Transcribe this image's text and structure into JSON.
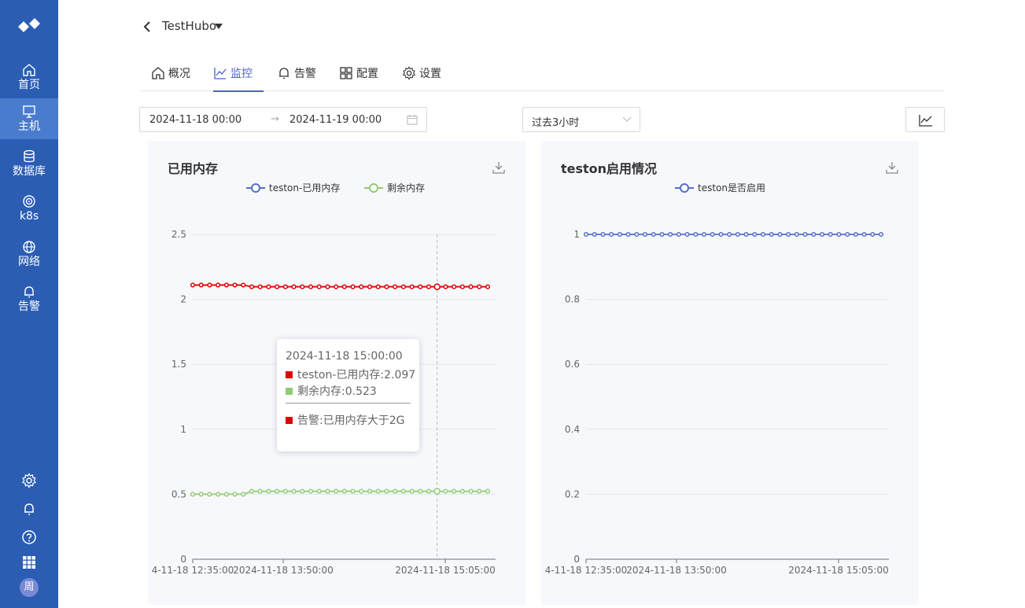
{
  "app": {
    "title": "TestHubo"
  },
  "sidebar": {
    "items": [
      {
        "label": "首页",
        "icon": "home-icon"
      },
      {
        "label": "主机",
        "icon": "monitor-icon"
      },
      {
        "label": "数据库",
        "icon": "database-icon"
      },
      {
        "label": "k8s",
        "icon": "k8s-icon"
      },
      {
        "label": "网络",
        "icon": "globe-icon"
      },
      {
        "label": "告警",
        "icon": "bell-icon"
      }
    ],
    "avatar": "周"
  },
  "tabs": [
    {
      "label": "概况",
      "icon": "home-icon"
    },
    {
      "label": "监控",
      "icon": "line-chart-icon"
    },
    {
      "label": "告警",
      "icon": "bell-icon"
    },
    {
      "label": "配置",
      "icon": "grid-icon"
    },
    {
      "label": "设置",
      "icon": "gear-icon"
    }
  ],
  "filters": {
    "date_start": "2024-11-18 00:00",
    "date_arrow": "→",
    "date_end": "2024-11-19 00:00",
    "range": "过去3小时"
  },
  "colors": {
    "accent": "#4a62c8",
    "sidebar": "#2b5db3",
    "red": "#e00000",
    "green": "#91cc75",
    "blue": "#5470c6"
  },
  "chart_data": [
    {
      "type": "line",
      "title": "已用内存",
      "legend": "top-center",
      "ylim": [
        0,
        2.5
      ],
      "yticks": [
        "0",
        "0.5",
        "1",
        "1.5",
        "2",
        "2.5"
      ],
      "xticks": [
        "4-11-18 12:35:00",
        "2024-11-18 13:50:00",
        "2024-11-18 15:05:00"
      ],
      "series": [
        {
          "name": "teston-已用内存",
          "color": "#e00000",
          "values": [
            2.11,
            2.11,
            2.11,
            2.11,
            2.11,
            2.11,
            2.11,
            2.097,
            2.097,
            2.097,
            2.097,
            2.097,
            2.097,
            2.097,
            2.097,
            2.097,
            2.097,
            2.097,
            2.097,
            2.097,
            2.097,
            2.097,
            2.097,
            2.097,
            2.097,
            2.097,
            2.097,
            2.097,
            2.097,
            2.097,
            2.097,
            2.097,
            2.097,
            2.097,
            2.097,
            2.097
          ]
        },
        {
          "name": "剩余内存",
          "color": "#91cc75",
          "values": [
            0.5,
            0.5,
            0.5,
            0.5,
            0.5,
            0.5,
            0.5,
            0.523,
            0.523,
            0.523,
            0.523,
            0.523,
            0.523,
            0.523,
            0.523,
            0.523,
            0.523,
            0.523,
            0.523,
            0.523,
            0.523,
            0.523,
            0.523,
            0.523,
            0.523,
            0.523,
            0.523,
            0.523,
            0.523,
            0.523,
            0.523,
            0.523,
            0.523,
            0.523,
            0.523,
            0.523
          ]
        }
      ],
      "tooltip": {
        "time": "2024-11-18 15:00:00",
        "rows": [
          {
            "text": "teston-已用内存:2.097",
            "color": "#e00000"
          },
          {
            "text": "剩余内存:0.523",
            "color": "#91cc75"
          }
        ],
        "alert": {
          "text": "告警:已用内存大于2G",
          "color": "#e00000"
        }
      }
    },
    {
      "type": "line",
      "title": "teston启用情况",
      "legend": "top-center",
      "ylim": [
        0,
        1
      ],
      "yticks": [
        "0",
        "0.2",
        "0.4",
        "0.6",
        "0.8",
        "1"
      ],
      "xticks": [
        "4-11-18 12:35:00",
        "2024-11-18 13:50:00",
        "2024-11-18 15:05:00"
      ],
      "series": [
        {
          "name": "teston是否启用",
          "color": "#5470c6",
          "values": [
            1,
            1,
            1,
            1,
            1,
            1,
            1,
            1,
            1,
            1,
            1,
            1,
            1,
            1,
            1,
            1,
            1,
            1,
            1,
            1,
            1,
            1,
            1,
            1,
            1,
            1,
            1,
            1,
            1,
            1,
            1,
            1,
            1,
            1,
            1,
            1
          ]
        }
      ]
    }
  ]
}
